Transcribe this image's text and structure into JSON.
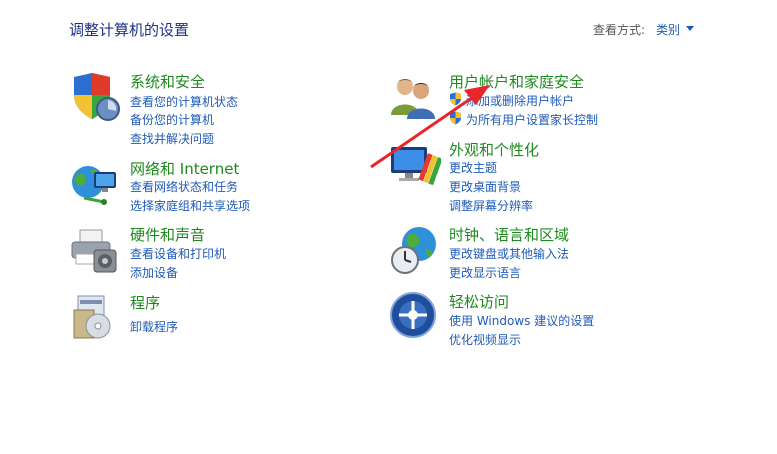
{
  "header": {
    "title": "调整计算机的设置",
    "view_by_label": "查看方式:",
    "view_by_value": "类别"
  },
  "categories": {
    "system": {
      "title": "系统和安全",
      "links": [
        "查看您的计算机状态",
        "备份您的计算机",
        "查找并解决问题"
      ]
    },
    "network": {
      "title": "网络和 Internet",
      "links": [
        "查看网络状态和任务",
        "选择家庭组和共享选项"
      ]
    },
    "hardware": {
      "title": "硬件和声音",
      "links": [
        "查看设备和打印机",
        "添加设备"
      ]
    },
    "programs": {
      "title": "程序",
      "links": [
        "卸载程序"
      ]
    },
    "accounts": {
      "title": "用户帐户和家庭安全",
      "links": [
        "添加或删除用户帐户",
        "为所有用户设置家长控制"
      ]
    },
    "appearance": {
      "title": "外观和个性化",
      "links": [
        "更改主题",
        "更改桌面背景",
        "调整屏幕分辨率"
      ]
    },
    "clock": {
      "title": "时钟、语言和区域",
      "links": [
        "更改键盘或其他输入法",
        "更改显示语言"
      ]
    },
    "ease": {
      "title": "轻松访问",
      "links": [
        "使用 Windows 建议的设置",
        "优化视频显示"
      ]
    }
  },
  "colors": {
    "link": "#1f5bb8",
    "heading": "#1e8a1e",
    "title": "#1e3287",
    "annotation_arrow": "#e8262b"
  }
}
